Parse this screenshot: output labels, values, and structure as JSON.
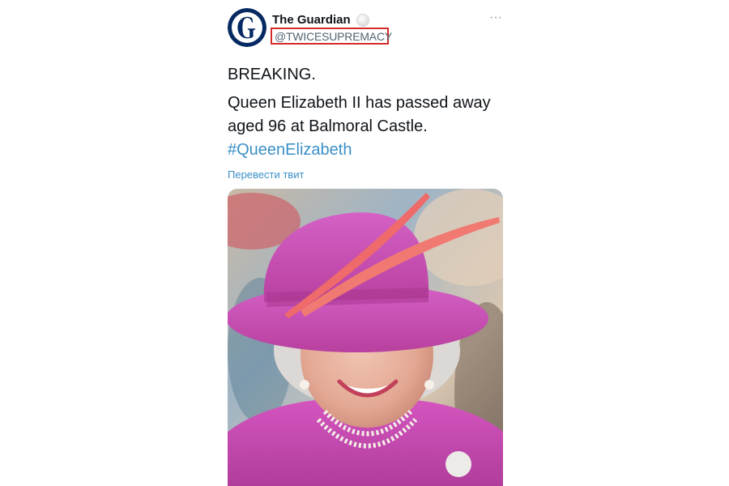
{
  "tweet": {
    "author": {
      "display_name": "The Guardian",
      "handle": "@TWICESUPREMACY",
      "avatar_icon": "guardian-logo-icon"
    },
    "text": {
      "line1": "BREAKING.",
      "line2": "Queen Elizabeth II has passed away aged 96 at Balmoral Castle.",
      "hashtag": "#QueenElizabeth"
    },
    "translate_label": "Перевести твит",
    "more_icon": "more-options-icon",
    "more_label": "···",
    "media_icon": "photo-of-queen-elizabeth"
  },
  "colors": {
    "link": "#3a8fc7",
    "highlight_box": "#d42a2a",
    "avatar_bg": "#052962"
  }
}
